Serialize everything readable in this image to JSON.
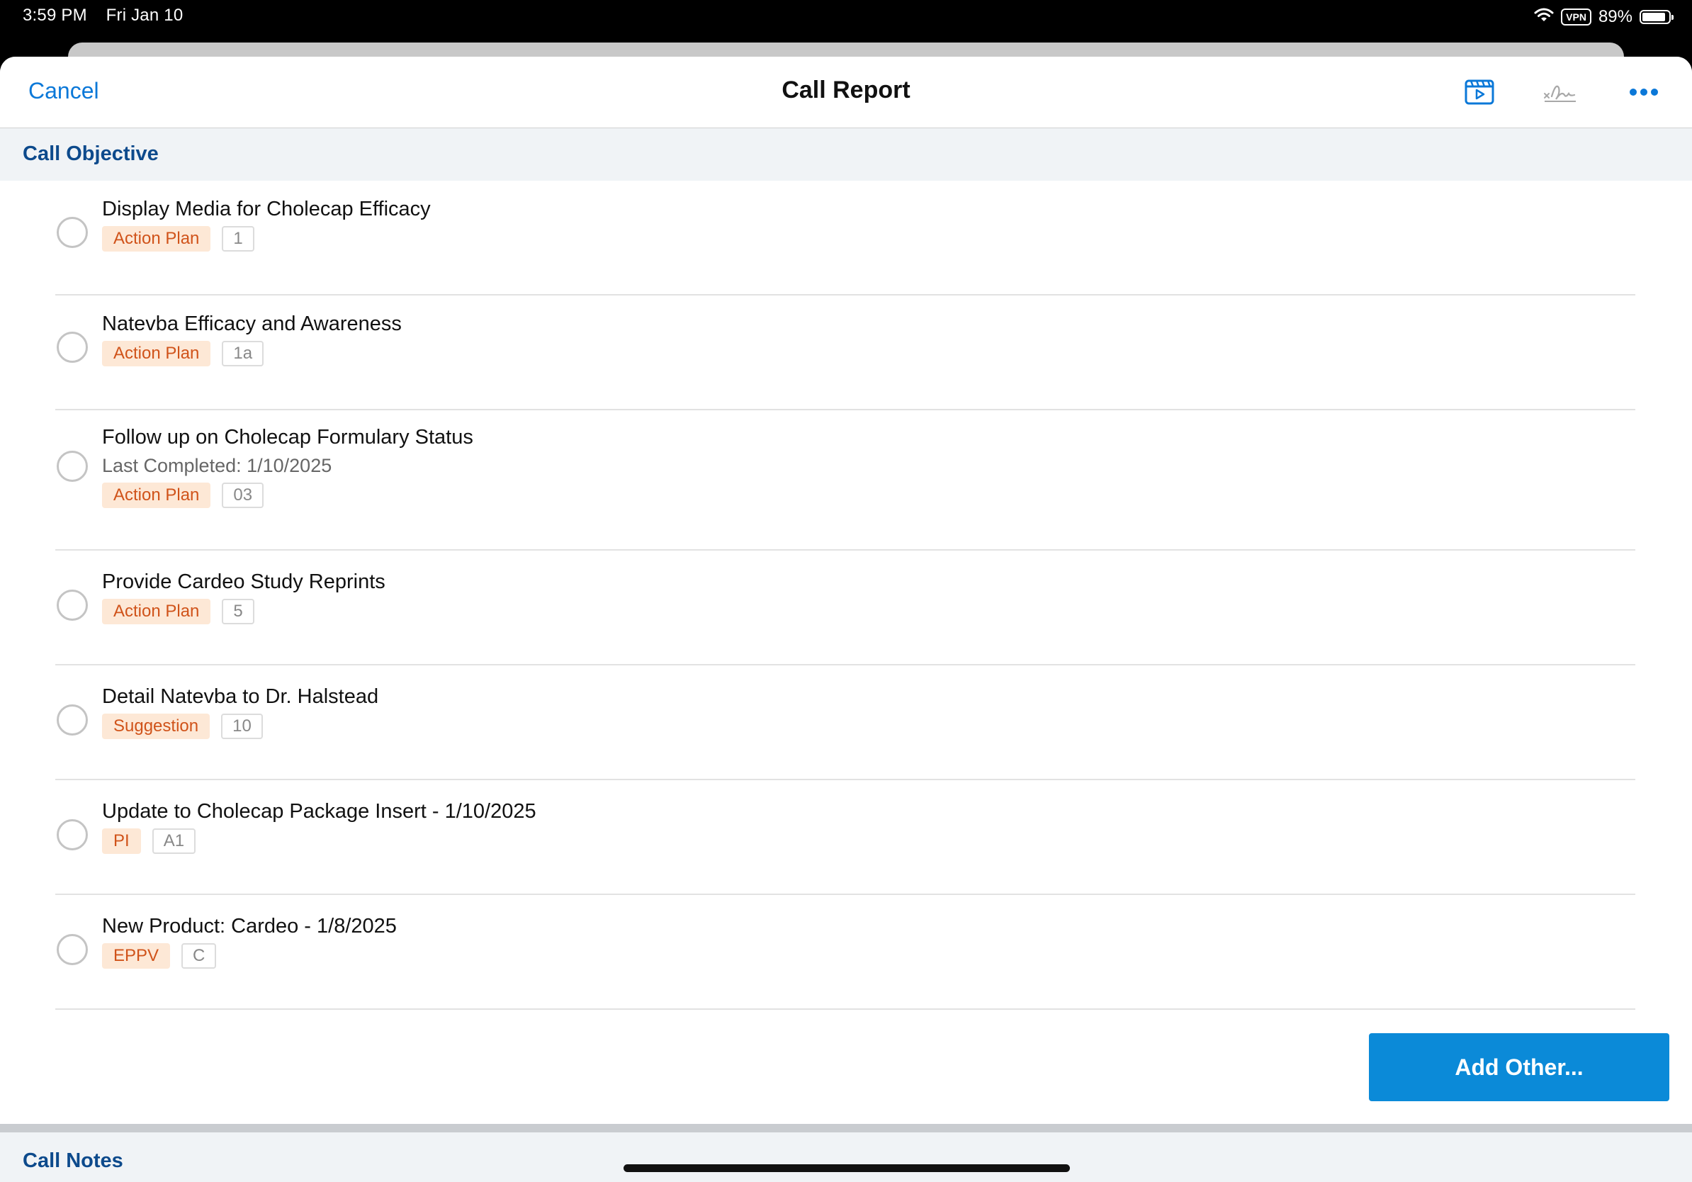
{
  "status_bar": {
    "time": "3:59 PM",
    "date": "Fri Jan 10",
    "vpn": "VPN",
    "battery": "89%",
    "battery_level": 0.89
  },
  "nav": {
    "cancel": "Cancel",
    "title": "Call Report"
  },
  "sections": {
    "objective": "Call Objective",
    "notes": "Call Notes"
  },
  "objectives": [
    {
      "title": "Display Media for Cholecap Efficacy",
      "subtitle": "",
      "type": "Action Plan",
      "num": "1"
    },
    {
      "title": "Natevba Efficacy and Awareness",
      "subtitle": "",
      "type": "Action Plan",
      "num": "1a"
    },
    {
      "title": "Follow up on Cholecap Formulary Status",
      "subtitle": "Last Completed: 1/10/2025",
      "type": "Action Plan",
      "num": "03"
    },
    {
      "title": "Provide Cardeo Study Reprints",
      "subtitle": "",
      "type": "Action Plan",
      "num": "5"
    },
    {
      "title": "Detail Natevba to Dr. Halstead",
      "subtitle": "",
      "type": "Suggestion",
      "num": "10"
    },
    {
      "title": "Update to Cholecap Package Insert - 1/10/2025",
      "subtitle": "",
      "type": "PI",
      "num": "A1"
    },
    {
      "title": "New Product: Cardeo - 1/8/2025",
      "subtitle": "",
      "type": "EPPV",
      "num": "C"
    }
  ],
  "add_button": "Add Other...",
  "colors": {
    "accent": "#0b78d8",
    "section_text": "#0d4a8c",
    "tag_text": "#d0531a",
    "tag_bg": "#fde8d6",
    "button_bg": "#0b8ad8"
  }
}
